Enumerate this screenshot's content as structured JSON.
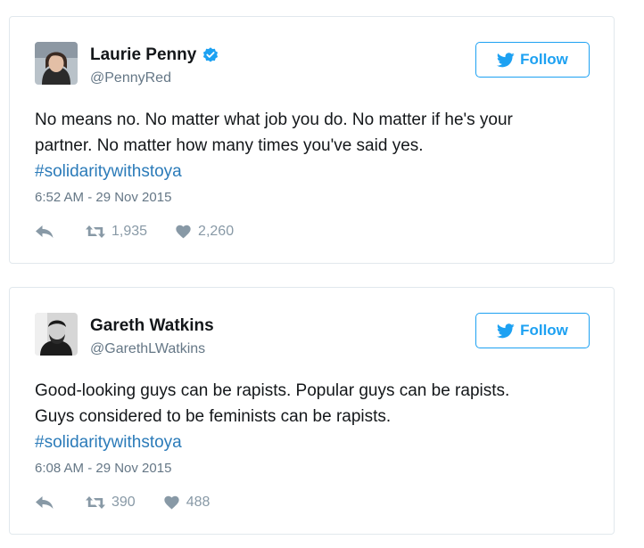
{
  "colors": {
    "brand": "#1da1f2",
    "hashtag": "#2b7bb9",
    "muted": "#657786",
    "icon": "#8899a6",
    "text": "#14171a",
    "verified": "#1da1f2"
  },
  "tweets": [
    {
      "display_name": "Laurie Penny",
      "verified": true,
      "handle": "@PennyRed",
      "follow_label": "Follow",
      "text_lines": [
        "No means no. No matter what job you do. No matter if he's your",
        "partner. No matter how many times you've said yes."
      ],
      "hashtag": "#solidaritywithstoya",
      "timestamp": "6:52 AM - 29 Nov 2015",
      "retweets": "1,935",
      "likes": "2,260",
      "icons": [
        "twitter-bird-icon",
        "reply-icon",
        "retweet-icon",
        "heart-icon",
        "verified-badge-icon"
      ]
    },
    {
      "display_name": "Gareth Watkins",
      "verified": false,
      "handle": "@GarethLWatkins",
      "follow_label": "Follow",
      "text_lines": [
        "Good-looking guys can be rapists. Popular guys can be rapists.",
        "Guys considered to be feminists can be rapists."
      ],
      "hashtag": "#solidaritywithstoya",
      "timestamp": "6:08 AM - 29 Nov 2015",
      "retweets": "390",
      "likes": "488",
      "icons": [
        "twitter-bird-icon",
        "reply-icon",
        "retweet-icon",
        "heart-icon"
      ]
    }
  ]
}
